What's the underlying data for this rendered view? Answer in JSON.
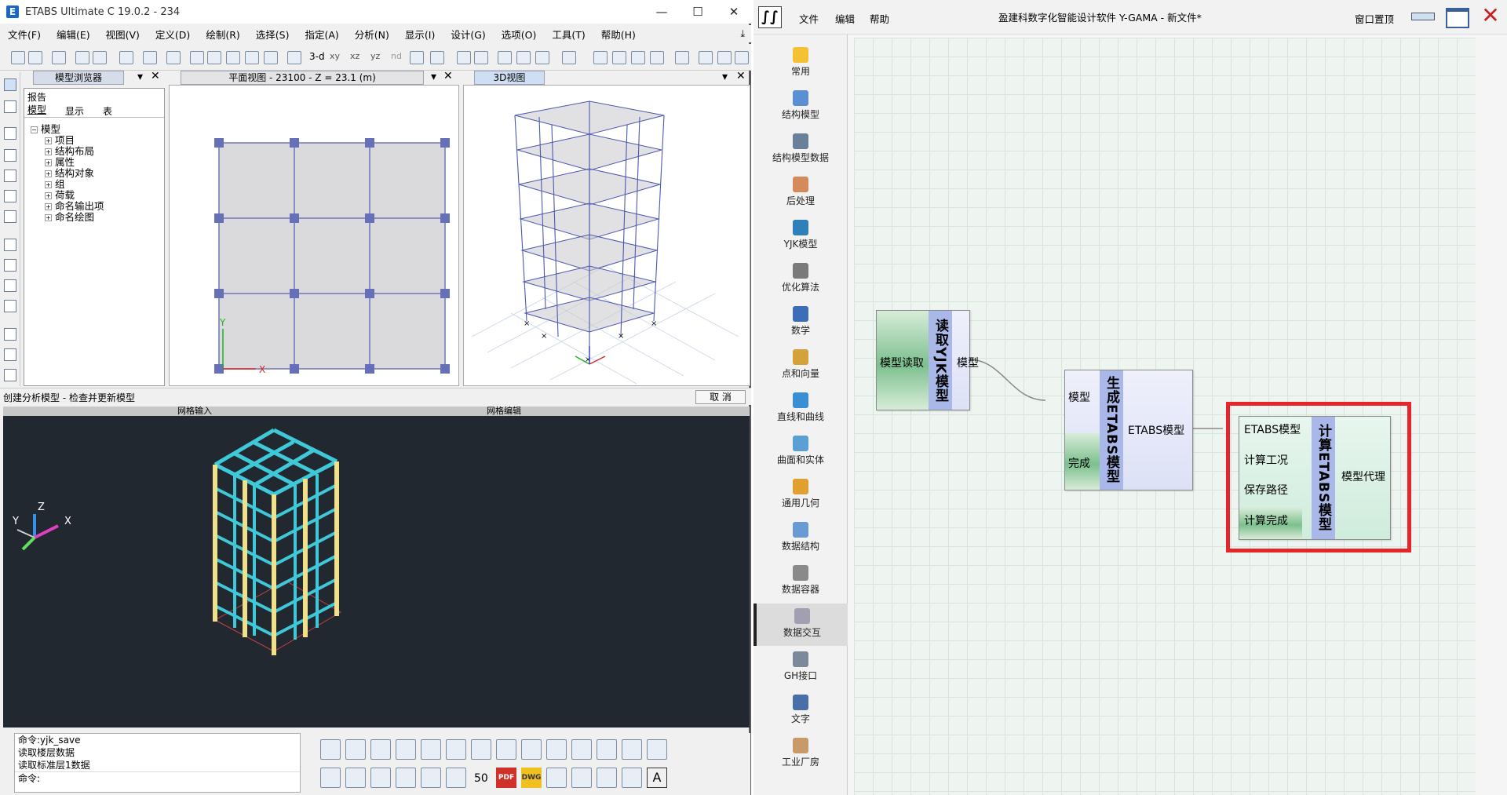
{
  "etabs": {
    "title": "ETABS Ultimate C 19.0.2 - 234",
    "menu": [
      "文件(F)",
      "编辑(E)",
      "视图(V)",
      "定义(D)",
      "绘制(R)",
      "选择(S)",
      "指定(A)",
      "分析(N)",
      "显示(I)",
      "设计(G)",
      "选项(O)",
      "工具(T)",
      "帮助(H)"
    ],
    "toolbar_text": [
      "3-d",
      "xy",
      "xz",
      "yz",
      "nd"
    ],
    "browser": {
      "title": "模型浏览器",
      "tabs_top": "报告",
      "tabs": [
        "模型",
        "显示",
        "表"
      ],
      "tree_root": "模型",
      "tree": [
        "项目",
        "结构布局",
        "属性",
        "结构对象",
        "组",
        "荷载",
        "命名输出项",
        "命名绘图"
      ]
    },
    "planview": {
      "title": "平面视图 - 23100 - Z = 23.1 (m)",
      "axis_x": "X",
      "axis_y": "Y"
    },
    "view3d": {
      "title": "3D视图"
    },
    "status": "创建分析模型 - 检查并更新模型",
    "cancel": "取 消"
  },
  "cad": {
    "tabs": [
      "网格输入",
      "网格编辑"
    ],
    "axes": {
      "x": "X",
      "y": "Y",
      "z": "Z"
    },
    "command_lines": [
      "命令:yjk_save",
      "读取楼层数据",
      "读取标准层1数据"
    ],
    "prompt": "命令:",
    "icon_labels": [
      "50",
      "PDF",
      "DWG",
      "A"
    ]
  },
  "gama": {
    "menu": [
      "文件",
      "编辑",
      "帮助"
    ],
    "title": "盈建科数字化智能设计软件 Y-GAMA - 新文件*",
    "window_top": "窗口置顶",
    "sidebar": [
      {
        "label": "常用",
        "icon": "star-icon",
        "color": "#f2c230"
      },
      {
        "label": "结构模型",
        "icon": "structure-model-icon",
        "color": "#5b8fd4"
      },
      {
        "label": "结构模型数据",
        "icon": "grid-data-icon",
        "color": "#6a7f9a"
      },
      {
        "label": "后处理",
        "icon": "postprocess-icon",
        "color": "#d48a5b"
      },
      {
        "label": "YJK模型",
        "icon": "yjk-icon",
        "color": "#2f7fb8"
      },
      {
        "label": "优化算法",
        "icon": "sigma-icon",
        "color": "#7a7a7a"
      },
      {
        "label": "数学",
        "icon": "pi-icon",
        "color": "#3a6fb8"
      },
      {
        "label": "点和向量",
        "icon": "point-vector-icon",
        "color": "#d4a23a"
      },
      {
        "label": "直线和曲线",
        "icon": "curve-icon",
        "color": "#3a8fd4"
      },
      {
        "label": "曲面和实体",
        "icon": "surface-icon",
        "color": "#5ba0d4"
      },
      {
        "label": "通用几何",
        "icon": "geometry-icon",
        "color": "#e0a030"
      },
      {
        "label": "数据结构",
        "icon": "data-structure-icon",
        "color": "#6a9ad4"
      },
      {
        "label": "数据容器",
        "icon": "data-container-icon",
        "color": "#8a8a8a"
      },
      {
        "label": "数据交互",
        "icon": "data-exchange-icon",
        "color": "#a0a0b0"
      },
      {
        "label": "GH接口",
        "icon": "gh-interface-icon",
        "color": "#7a8a9a"
      },
      {
        "label": "文字",
        "icon": "text-icon",
        "color": "#4a6fa8"
      },
      {
        "label": "工业厂房",
        "icon": "factory-icon",
        "color": "#c89a6a"
      }
    ],
    "active_sidebar": "数据交互",
    "nodes": {
      "read_yjk": {
        "title": "读取YJK模型",
        "input": "模型读取",
        "output": "模型"
      },
      "gen_etabs": {
        "title": "生成ETABS模型",
        "inputs": [
          "模型",
          "完成"
        ],
        "output": "ETABS模型"
      },
      "calc_etabs": {
        "title": "计算ETABS模型",
        "inputs": [
          "ETABS模型",
          "计算工况",
          "保存路径",
          "计算完成"
        ],
        "output": "模型代理"
      }
    },
    "highlight_color": "#e5252a"
  }
}
